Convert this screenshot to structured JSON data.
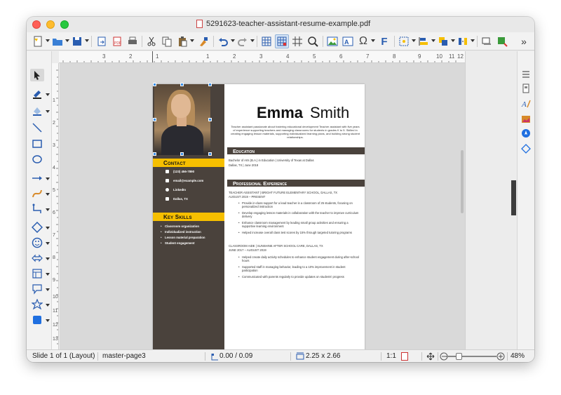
{
  "window": {
    "title": "5291623-teacher-assistant-resume-example.pdf"
  },
  "toolbar": {
    "more": "»"
  },
  "ruler": {
    "h_numbers": [
      "3",
      "2",
      "1",
      "1",
      "2",
      "3",
      "4",
      "5",
      "6",
      "7",
      "8",
      "9",
      "10",
      "11",
      "12"
    ],
    "v_numbers": [
      "1",
      "2",
      "3",
      "4",
      "5",
      "6",
      "7",
      "8",
      "9",
      "10",
      "11",
      "12",
      "13"
    ]
  },
  "resume": {
    "first_name": "Emma",
    "last_name": "Smith",
    "summary": "Teacher assistant passionate about fostering educational development Teacher assistant with five years of experience supporting teachers and managing classrooms for students in grades K to 5. Skilled in creating engaging lesson materials, supporting individualized learning plans, and building strong student relationships.",
    "contact_heading": "Contact",
    "contact": [
      "(123) 456-7890",
      "email@example.com",
      "LinkedIn",
      "Dallas, TX"
    ],
    "skills_heading": "Key Skills",
    "skills": [
      "Classroom organization",
      "Individualized instruction",
      "Lesson material preparation",
      "Student engagement"
    ],
    "education_heading": "Education",
    "education_line1": "Bachelor of Arts (B.A.) in Education  |  University of Texas at Dallas",
    "education_line2": "Dallas, TX  |  June 2018",
    "experience_heading": "Professional Experience",
    "job1_title": "TEACHER ASSISTANT | BRIGHT FUTURE ELEMENTARY SCHOOL, DALLAS, TX",
    "job1_dates": "AUGUST 2019 – PRESENT",
    "job1_bullets": [
      "Provide in-class support for a lead teacher in a classroom of 25 students, focusing on personalized instruction",
      "Develop engaging lesson materials in collaboration with the teacher to improve curriculum delivery",
      "Enhance classroom management by leading small group activities and ensuring a supportive learning environment",
      "Helped increase overall class test scores by 15% through targeted tutoring programs"
    ],
    "job2_title": "CLASSROOM AIDE | SUNSHINE AFTER SCHOOL CARE, DALLAS, TX",
    "job2_dates": "JUNE 2017 – AUGUST 2019",
    "job2_bullets": [
      "Helped create daily activity schedules to enhance student engagement during after-school hours",
      "Supported staff in managing behavior, leading to a 10% improvement in student participation",
      "Communicated with parents regularly to provide updates on students' progress"
    ]
  },
  "status": {
    "slide": "Slide 1 of 1 (Layout)",
    "master": "master-page3",
    "position": "0.00 / 0.09",
    "size": "2.25 x 2.66",
    "scale": "1:1",
    "zoom": "48%"
  }
}
